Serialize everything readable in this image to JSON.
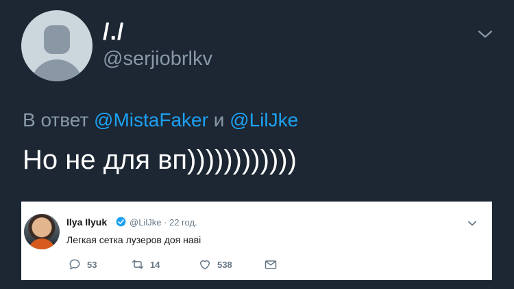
{
  "tweet": {
    "display_name": "/./",
    "handle": "@serjiobrlkv",
    "reply_prefix": "В ответ",
    "reply_to_1": "@MistaFaker",
    "reply_join": "и",
    "reply_to_2": "@LilJke",
    "text": "Но не для вп))))))))))))"
  },
  "quoted": {
    "name": "Ilya Ilyuk",
    "meta": "@LilJke · 22 год.",
    "text": "Легкая сетка лузеров доя наві",
    "replies": "53",
    "retweets": "14",
    "likes": "538"
  },
  "colors": {
    "background": "#1c2733",
    "accent": "#1da1f2",
    "muted": "#8899a6"
  },
  "icons": [
    "default-avatar-icon",
    "chevron-down-icon",
    "verified-badge-icon",
    "reply-icon",
    "retweet-icon",
    "like-icon",
    "direct-message-icon"
  ]
}
